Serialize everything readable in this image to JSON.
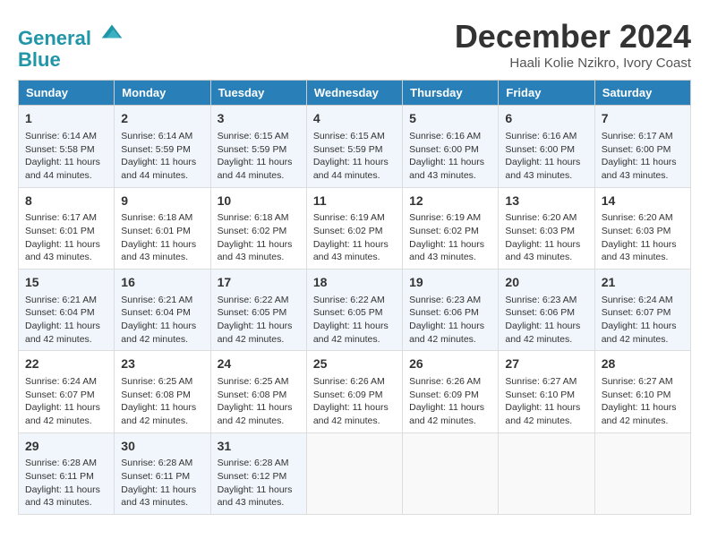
{
  "logo": {
    "line1": "General",
    "line2": "Blue"
  },
  "header": {
    "month": "December 2024",
    "location": "Haali Kolie Nzikro, Ivory Coast"
  },
  "weekdays": [
    "Sunday",
    "Monday",
    "Tuesday",
    "Wednesday",
    "Thursday",
    "Friday",
    "Saturday"
  ],
  "weeks": [
    [
      {
        "day": "1",
        "sunrise": "6:14 AM",
        "sunset": "5:58 PM",
        "daylight": "11 hours and 44 minutes."
      },
      {
        "day": "2",
        "sunrise": "6:14 AM",
        "sunset": "5:59 PM",
        "daylight": "11 hours and 44 minutes."
      },
      {
        "day": "3",
        "sunrise": "6:15 AM",
        "sunset": "5:59 PM",
        "daylight": "11 hours and 44 minutes."
      },
      {
        "day": "4",
        "sunrise": "6:15 AM",
        "sunset": "5:59 PM",
        "daylight": "11 hours and 44 minutes."
      },
      {
        "day": "5",
        "sunrise": "6:16 AM",
        "sunset": "6:00 PM",
        "daylight": "11 hours and 43 minutes."
      },
      {
        "day": "6",
        "sunrise": "6:16 AM",
        "sunset": "6:00 PM",
        "daylight": "11 hours and 43 minutes."
      },
      {
        "day": "7",
        "sunrise": "6:17 AM",
        "sunset": "6:00 PM",
        "daylight": "11 hours and 43 minutes."
      }
    ],
    [
      {
        "day": "8",
        "sunrise": "6:17 AM",
        "sunset": "6:01 PM",
        "daylight": "11 hours and 43 minutes."
      },
      {
        "day": "9",
        "sunrise": "6:18 AM",
        "sunset": "6:01 PM",
        "daylight": "11 hours and 43 minutes."
      },
      {
        "day": "10",
        "sunrise": "6:18 AM",
        "sunset": "6:02 PM",
        "daylight": "11 hours and 43 minutes."
      },
      {
        "day": "11",
        "sunrise": "6:19 AM",
        "sunset": "6:02 PM",
        "daylight": "11 hours and 43 minutes."
      },
      {
        "day": "12",
        "sunrise": "6:19 AM",
        "sunset": "6:02 PM",
        "daylight": "11 hours and 43 minutes."
      },
      {
        "day": "13",
        "sunrise": "6:20 AM",
        "sunset": "6:03 PM",
        "daylight": "11 hours and 43 minutes."
      },
      {
        "day": "14",
        "sunrise": "6:20 AM",
        "sunset": "6:03 PM",
        "daylight": "11 hours and 43 minutes."
      }
    ],
    [
      {
        "day": "15",
        "sunrise": "6:21 AM",
        "sunset": "6:04 PM",
        "daylight": "11 hours and 42 minutes."
      },
      {
        "day": "16",
        "sunrise": "6:21 AM",
        "sunset": "6:04 PM",
        "daylight": "11 hours and 42 minutes."
      },
      {
        "day": "17",
        "sunrise": "6:22 AM",
        "sunset": "6:05 PM",
        "daylight": "11 hours and 42 minutes."
      },
      {
        "day": "18",
        "sunrise": "6:22 AM",
        "sunset": "6:05 PM",
        "daylight": "11 hours and 42 minutes."
      },
      {
        "day": "19",
        "sunrise": "6:23 AM",
        "sunset": "6:06 PM",
        "daylight": "11 hours and 42 minutes."
      },
      {
        "day": "20",
        "sunrise": "6:23 AM",
        "sunset": "6:06 PM",
        "daylight": "11 hours and 42 minutes."
      },
      {
        "day": "21",
        "sunrise": "6:24 AM",
        "sunset": "6:07 PM",
        "daylight": "11 hours and 42 minutes."
      }
    ],
    [
      {
        "day": "22",
        "sunrise": "6:24 AM",
        "sunset": "6:07 PM",
        "daylight": "11 hours and 42 minutes."
      },
      {
        "day": "23",
        "sunrise": "6:25 AM",
        "sunset": "6:08 PM",
        "daylight": "11 hours and 42 minutes."
      },
      {
        "day": "24",
        "sunrise": "6:25 AM",
        "sunset": "6:08 PM",
        "daylight": "11 hours and 42 minutes."
      },
      {
        "day": "25",
        "sunrise": "6:26 AM",
        "sunset": "6:09 PM",
        "daylight": "11 hours and 42 minutes."
      },
      {
        "day": "26",
        "sunrise": "6:26 AM",
        "sunset": "6:09 PM",
        "daylight": "11 hours and 42 minutes."
      },
      {
        "day": "27",
        "sunrise": "6:27 AM",
        "sunset": "6:10 PM",
        "daylight": "11 hours and 42 minutes."
      },
      {
        "day": "28",
        "sunrise": "6:27 AM",
        "sunset": "6:10 PM",
        "daylight": "11 hours and 42 minutes."
      }
    ],
    [
      {
        "day": "29",
        "sunrise": "6:28 AM",
        "sunset": "6:11 PM",
        "daylight": "11 hours and 43 minutes."
      },
      {
        "day": "30",
        "sunrise": "6:28 AM",
        "sunset": "6:11 PM",
        "daylight": "11 hours and 43 minutes."
      },
      {
        "day": "31",
        "sunrise": "6:28 AM",
        "sunset": "6:12 PM",
        "daylight": "11 hours and 43 minutes."
      },
      null,
      null,
      null,
      null
    ]
  ]
}
